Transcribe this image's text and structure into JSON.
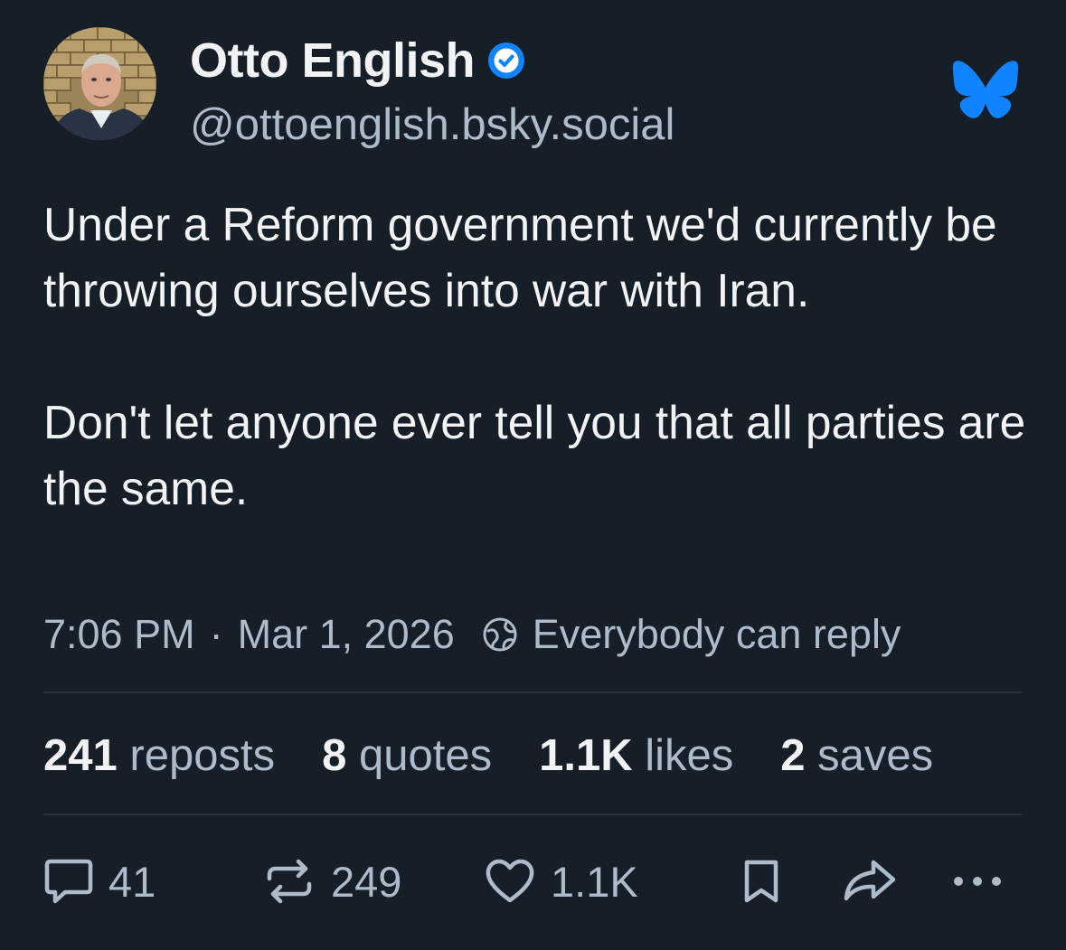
{
  "post": {
    "author": {
      "display_name": "Otto English",
      "handle": "@ottoenglish.bsky.social",
      "verified": true
    },
    "paragraphs": [
      "Under a Reform government we'd currently be throwing ourselves into war with Iran.",
      "Don't let anyone ever tell you that all parties are the same."
    ],
    "time": "7:06 PM",
    "separator": "·",
    "date": "Mar 1, 2026",
    "reply_setting": "Everybody can reply"
  },
  "stats": {
    "reposts": {
      "count": "241",
      "label": "reposts"
    },
    "quotes": {
      "count": "8",
      "label": "quotes"
    },
    "likes": {
      "count": "1.1K",
      "label": "likes"
    },
    "saves": {
      "count": "2",
      "label": "saves"
    }
  },
  "actions": {
    "reply_count": "41",
    "repost_count": "249",
    "like_count": "1.1K"
  },
  "icons": {
    "verified": "verified-check-icon",
    "app_logo": "bluesky-butterfly-icon",
    "reply_setting": "globe-icon",
    "reply": "speech-bubble-icon",
    "repost": "repost-arrows-icon",
    "like": "heart-icon",
    "save": "bookmark-icon",
    "share": "share-arrow-icon",
    "more": "more-dots-icon"
  },
  "colors": {
    "background": "#161e27",
    "text_primary": "#f1f3f5",
    "text_secondary": "#aebbc9",
    "accent": "#1083fe",
    "divider": "#26323f"
  }
}
